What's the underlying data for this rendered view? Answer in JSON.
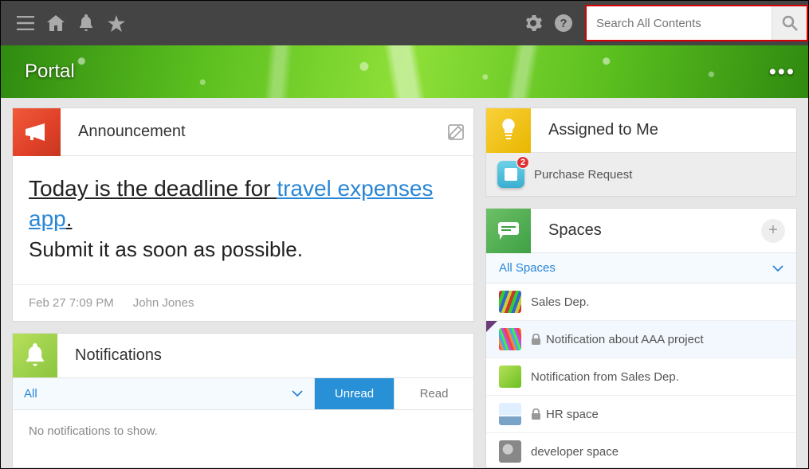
{
  "search": {
    "placeholder": "Search All Contents"
  },
  "banner": {
    "title": "Portal"
  },
  "announcement": {
    "card_title": "Announcement",
    "headline_prefix": "Today is the deadline for ",
    "headline_link": "travel expenses app",
    "headline_suffix": ".",
    "body": "Submit it as soon as possible.",
    "meta_time": "Feb 27 7:09 PM",
    "meta_author": "John Jones"
  },
  "notifications": {
    "card_title": "Notifications",
    "filter_all": "All",
    "filter_unread": "Unread",
    "filter_read": "Read",
    "empty": "No notifications to show."
  },
  "assigned": {
    "card_title": "Assigned to Me",
    "items": [
      {
        "label": "Purchase Request",
        "badge": "2"
      }
    ]
  },
  "spaces": {
    "card_title": "Spaces",
    "filter": "All Spaces",
    "items": [
      {
        "label": "Sales Dep.",
        "locked": false,
        "active": false,
        "thumb": "thumb1"
      },
      {
        "label": "Notification about AAA project",
        "locked": true,
        "active": true,
        "thumb": "thumb2"
      },
      {
        "label": "Notification from Sales Dep.",
        "locked": false,
        "active": false,
        "thumb": "thumb3"
      },
      {
        "label": "HR space",
        "locked": true,
        "active": false,
        "thumb": "thumb4"
      },
      {
        "label": "developer space",
        "locked": false,
        "active": false,
        "thumb": "thumb5"
      }
    ]
  }
}
